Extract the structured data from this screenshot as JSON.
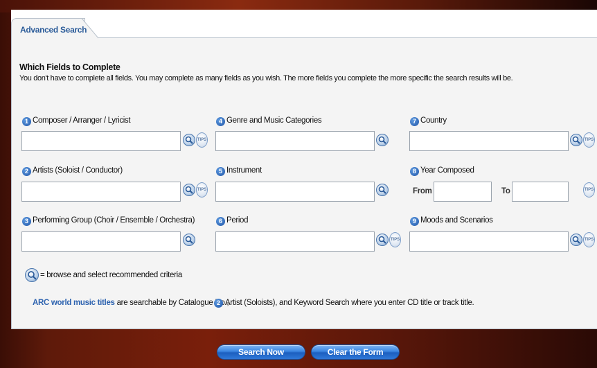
{
  "tab": {
    "label": "Advanced Search"
  },
  "section": {
    "heading": "Which Fields to Complete",
    "intro": "You don't have to complete all fields. You may complete as many fields as you wish. The more fields you complete the more specific the search results will be."
  },
  "fields": {
    "f1": {
      "num": "1",
      "label": "Composer / Arranger / Lyricist",
      "value": ""
    },
    "f2": {
      "num": "2",
      "label": "Artists (Soloist / Conductor)",
      "value": ""
    },
    "f3": {
      "num": "3",
      "label": "Performing Group (Choir / Ensemble / Orchestra)",
      "value": ""
    },
    "f4": {
      "num": "4",
      "label": "Genre and Music Categories",
      "value": ""
    },
    "f5": {
      "num": "5",
      "label": "Instrument",
      "value": ""
    },
    "f6": {
      "num": "6",
      "label": "Period",
      "value": ""
    },
    "f7": {
      "num": "7",
      "label": "Country",
      "value": ""
    },
    "f8": {
      "num": "8",
      "label": "Year Composed",
      "from_label": "From",
      "to_label": "To",
      "from_value": "",
      "to_value": ""
    },
    "f9": {
      "num": "9",
      "label": "Moods and Scenarios",
      "value": ""
    }
  },
  "icons": {
    "browse": "magnifier-icon",
    "tips": "TIPS"
  },
  "legend": {
    "text": "= browse and select recommended criteria"
  },
  "note": {
    "link": "ARC world music titles",
    "text1": "are searchable by Catalogue No.,",
    "num": "2",
    "text2": "Artist (Soloists), and Keyword Search where you enter CD title or track title."
  },
  "buttons": {
    "search": "Search Now",
    "clear": "Clear the Form"
  }
}
